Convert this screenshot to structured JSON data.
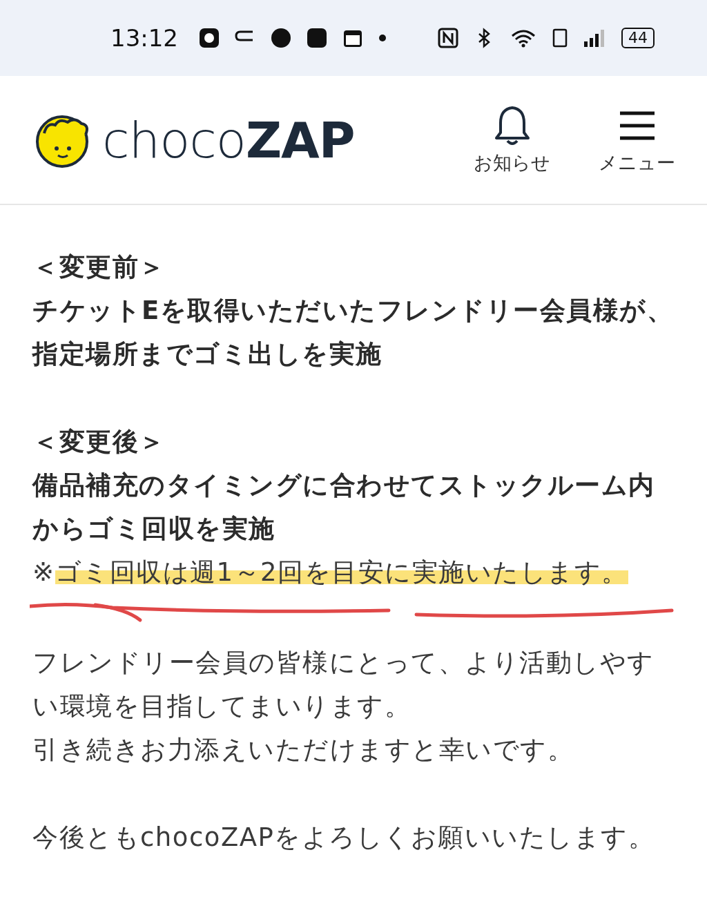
{
  "status_bar": {
    "time": "13:12",
    "battery": "44"
  },
  "header": {
    "logo": "choco**ZAP**",
    "notice": {
      "label": "お知らせ"
    },
    "menu": {
      "label": "メニュー"
    }
  },
  "sections": [
    {
      "lines": [
        {
          "kind": "heading",
          "text": "＜変更前＞"
        },
        {
          "kind": "bold",
          "text": "チケットEを取得いただいたフレンドリー会員様が、指定場所までゴミ出しを実施"
        }
      ]
    },
    {
      "lines": [
        {
          "kind": "heading",
          "text": "＜変更後＞"
        },
        {
          "kind": "bold",
          "text": "備品補充のタイミングに合わせてストックルーム内からゴミ回収を実施"
        },
        {
          "kind": "note",
          "mark": "※",
          "text": "ゴミ回収は週1～2回を目安に実施いたします。"
        },
        {
          "kind": "scribble"
        },
        {
          "kind": "plain",
          "text": "フレンドリー会員の皆様にとって、より活動しやすい環境を目指してまいります。"
        },
        {
          "kind": "plain",
          "text": "引き続きお力添えいただけますと幸いです。"
        }
      ]
    },
    {
      "lines": [
        {
          "kind": "plain",
          "text": "今後ともchocoZAPをよろしくお願いいたします。"
        }
      ]
    }
  ]
}
